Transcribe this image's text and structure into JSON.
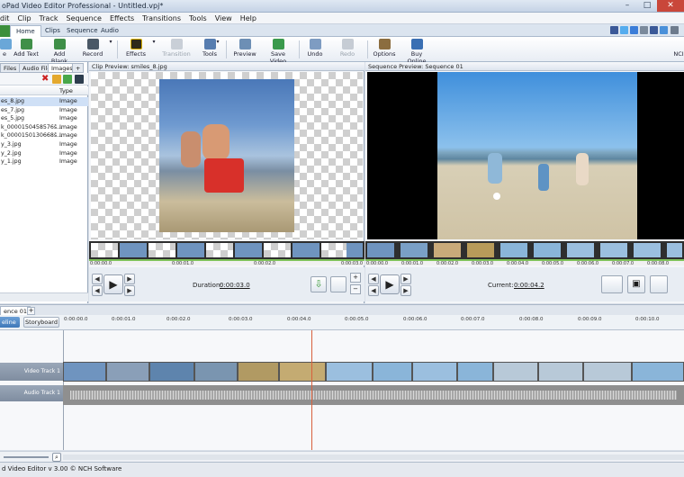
{
  "window": {
    "title": "oPad Video Editor Professional - Untitled.vpj*"
  },
  "menu": [
    "dit",
    "Clip",
    "Track",
    "Sequence",
    "Effects",
    "Transitions",
    "Tools",
    "View",
    "Help"
  ],
  "ribbon_tabs": [
    "Home",
    "Clips",
    "Sequence",
    "Audio"
  ],
  "toolbar": {
    "items": [
      "e",
      "Add Text",
      "Add Blank",
      "Record",
      "Effects",
      "Transition",
      "Tools",
      "Preview",
      "Save Video",
      "Undo",
      "Redo",
      "Options",
      "Buy Online"
    ],
    "right_label": "NCI"
  },
  "media": {
    "tabs": [
      "Files",
      "Audio Files",
      "Images",
      "+"
    ],
    "type_header": "Type",
    "rows": [
      {
        "name": "es_8.jpg",
        "type": "Image"
      },
      {
        "name": "es_7.jpg",
        "type": "Image"
      },
      {
        "name": "es_5.jpg",
        "type": "Image"
      },
      {
        "name": "k_0000150458576š...",
        "type": "Image"
      },
      {
        "name": "k_0000150130668š...",
        "type": "Image"
      },
      {
        "name": "y_3.jpg",
        "type": "Image"
      },
      {
        "name": "y_2.jpg",
        "type": "Image"
      },
      {
        "name": "y_1.jpg",
        "type": "Image"
      }
    ]
  },
  "clip_preview": {
    "header": "Clip Preview: smiles_8.jpg",
    "ruler": [
      "0:00:00.0",
      "0:00:01.0",
      "0:00:02.0",
      "0:00:03.0"
    ],
    "duration_label": "Duration:",
    "duration_value": "0:00:03.0"
  },
  "sequence_preview": {
    "header": "Sequence Preview: Sequence 01",
    "ruler": [
      "0:00:00.0",
      "0:00:01.0",
      "0:00:02.0",
      "0:00:03.0",
      "0:00:04.0",
      "0:00:05.0",
      "0:00:06.0",
      "0:00:07.0",
      "0:00:08.0"
    ],
    "current_label": "Current:",
    "current_value": "0:00:04.2"
  },
  "timeline": {
    "tab": "ence 01",
    "mode_buttons": [
      "eline",
      "Storyboard"
    ],
    "ticks": [
      "0:00:00.0",
      "0:00:01.0",
      "0:00:02.0",
      "0:00:03.0",
      "0:00:04.0",
      "0:00:05.0",
      "0:00:06.0",
      "0:00:07.0",
      "0:00:08.0",
      "0:00:09.0",
      "0:00:10.0"
    ],
    "video_track": "Video Track 1",
    "audio_track": "Audio Track 1"
  },
  "status": {
    "text": "d Video Editor v 3.00 © NCH Software"
  },
  "colors": {
    "accent": "#7fc25a",
    "playhead": "#d8603c",
    "selection": "#cfe0f6"
  }
}
